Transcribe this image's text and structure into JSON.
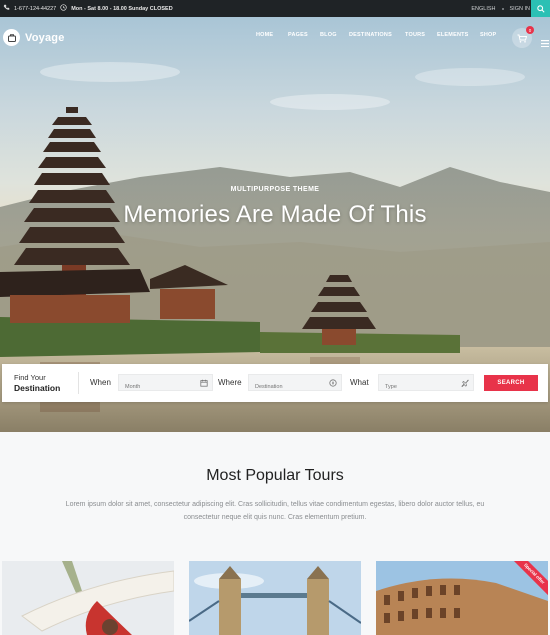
{
  "topbar": {
    "phone": "1-677-124-44227",
    "hours": "Mon - Sat 8.00 - 18.00 Sunday CLOSED",
    "language": "ENGLISH",
    "signin": "SIGN IN"
  },
  "header": {
    "logo": "Voyage",
    "nav": [
      "HOME",
      "PAGES",
      "BLOG",
      "DESTINATIONS",
      "TOURS",
      "ELEMENTS",
      "SHOP"
    ],
    "cart_count": "0"
  },
  "hero": {
    "kicker": "MULTIPURPOSE THEME",
    "headline": "Memories Are Made Of This"
  },
  "search": {
    "find_line1": "Find Your",
    "find_line2": "Destination",
    "when_label": "When",
    "when_placeholder": "Month",
    "where_label": "Where",
    "where_placeholder": "Destination",
    "what_label": "What",
    "what_placeholder": "Type",
    "button": "SEARCH"
  },
  "popular": {
    "title": "Most Popular Tours",
    "description": "Lorem ipsum dolor sit amet, consectetur adipiscing elit. Cras sollicitudin, tellus vitae condimentum egestas, libero dolor auctor tellus, eu consectetur neque elit quis nunc. Cras elementum pretium.",
    "ribbon": "Special offer"
  },
  "colors": {
    "accent": "#e8334a",
    "topbar": "#1f2326",
    "search_button_top": "#2bc0b4"
  }
}
